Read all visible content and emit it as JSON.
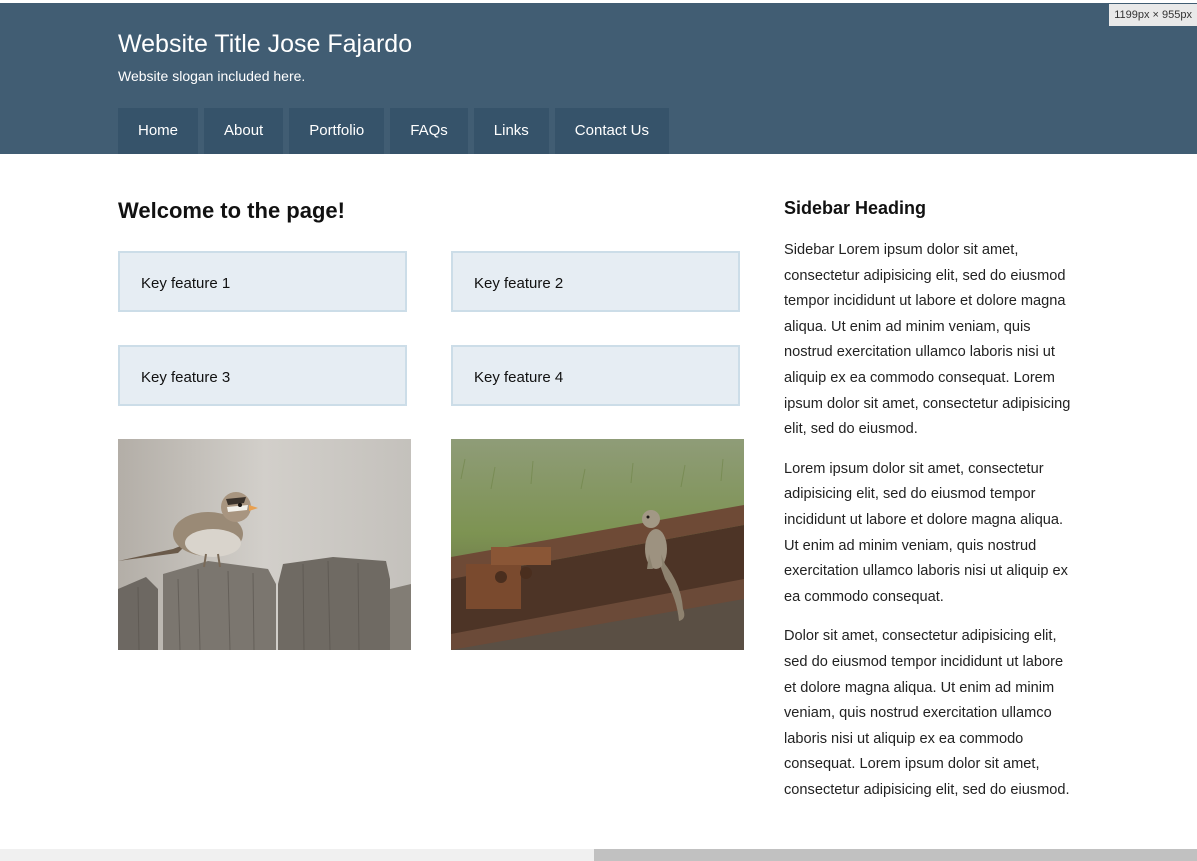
{
  "header": {
    "title": "Website Title Jose Fajardo",
    "slogan": "Website slogan included here.",
    "background_color": "#415d73",
    "nav_color": "#36536a"
  },
  "nav": {
    "items": [
      {
        "label": "Home"
      },
      {
        "label": "About"
      },
      {
        "label": "Portfolio"
      },
      {
        "label": "FAQs"
      },
      {
        "label": "Links"
      },
      {
        "label": "Contact Us"
      }
    ]
  },
  "devtools": {
    "dimensions_badge": "1199px × 955px"
  },
  "main": {
    "heading": "Welcome to the page!",
    "features": [
      {
        "label": "Key feature 1"
      },
      {
        "label": "Key feature 2"
      },
      {
        "label": "Key feature 3"
      },
      {
        "label": "Key feature 4"
      }
    ],
    "images": [
      {
        "subject": "sparrow-on-fence"
      },
      {
        "subject": "squirrel-on-railroad-track"
      }
    ]
  },
  "sidebar": {
    "heading": "Sidebar Heading",
    "paragraphs": [
      "Sidebar Lorem ipsum dolor sit amet, consectetur adipisicing elit, sed do eiusmod tempor incididunt ut labore et dolore magna aliqua. Ut enim ad minim veniam, quis nostrud exercitation ullamco laboris nisi ut aliquip ex ea commodo consequat. Lorem ipsum dolor sit amet, consectetur adipisicing elit, sed do eiusmod.",
      "Lorem ipsum dolor sit amet, consectetur adipisicing elit, sed do eiusmod tempor incididunt ut labore et dolore magna aliqua. Ut enim ad minim veniam, quis nostrud exercitation ullamco laboris nisi ut aliquip ex ea commodo consequat.",
      "Dolor sit amet, consectetur adipisicing elit, sed do eiusmod tempor incididunt ut labore et dolore magna aliqua. Ut enim ad minim veniam, quis nostrud exercitation ullamco laboris nisi ut aliquip ex ea commodo consequat. Lorem ipsum dolor sit amet, consectetur adipisicing elit, sed do eiusmod."
    ]
  }
}
